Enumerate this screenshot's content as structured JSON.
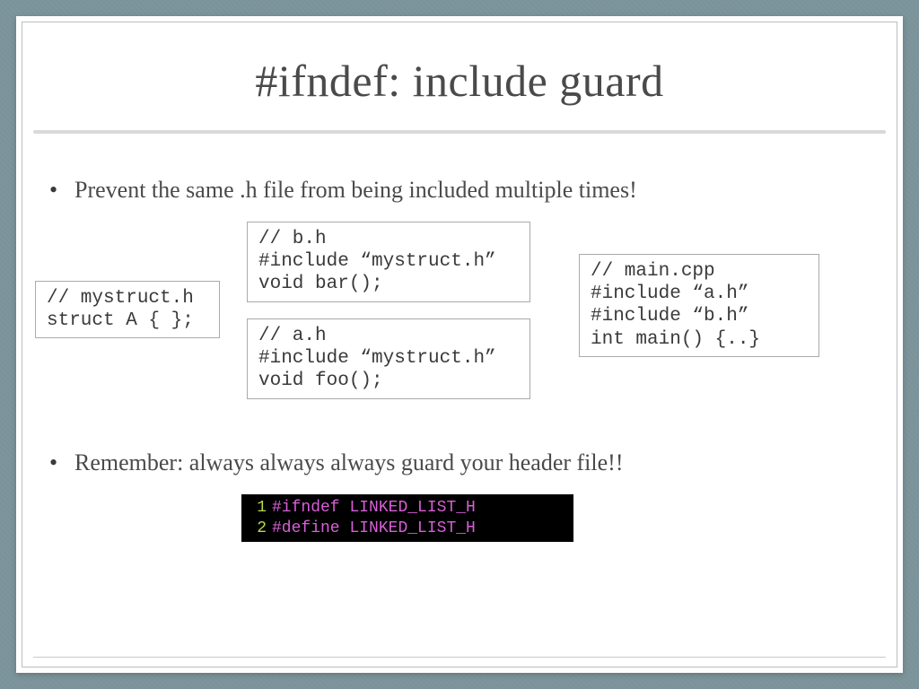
{
  "title": "#ifndef: include guard",
  "bullets": {
    "b1": "Prevent the same .h file from being included multiple times!",
    "b2": "Remember: always always always guard your header file!!"
  },
  "code": {
    "mystruct": "// mystruct.h\nstruct A { };",
    "bh": "// b.h\n#include “mystruct.h”\nvoid bar();",
    "ah": "// a.h\n#include “mystruct.h”\nvoid foo();",
    "main": "// main.cpp\n#include “a.h”\n#include “b.h”\nint main() {..}"
  },
  "terminal": {
    "l1": {
      "num": "1",
      "kw": "#ifndef",
      "id": "LINKED_LIST_H"
    },
    "l2": {
      "num": "2",
      "kw": "#define",
      "id": "LINKED_LIST_H"
    }
  }
}
